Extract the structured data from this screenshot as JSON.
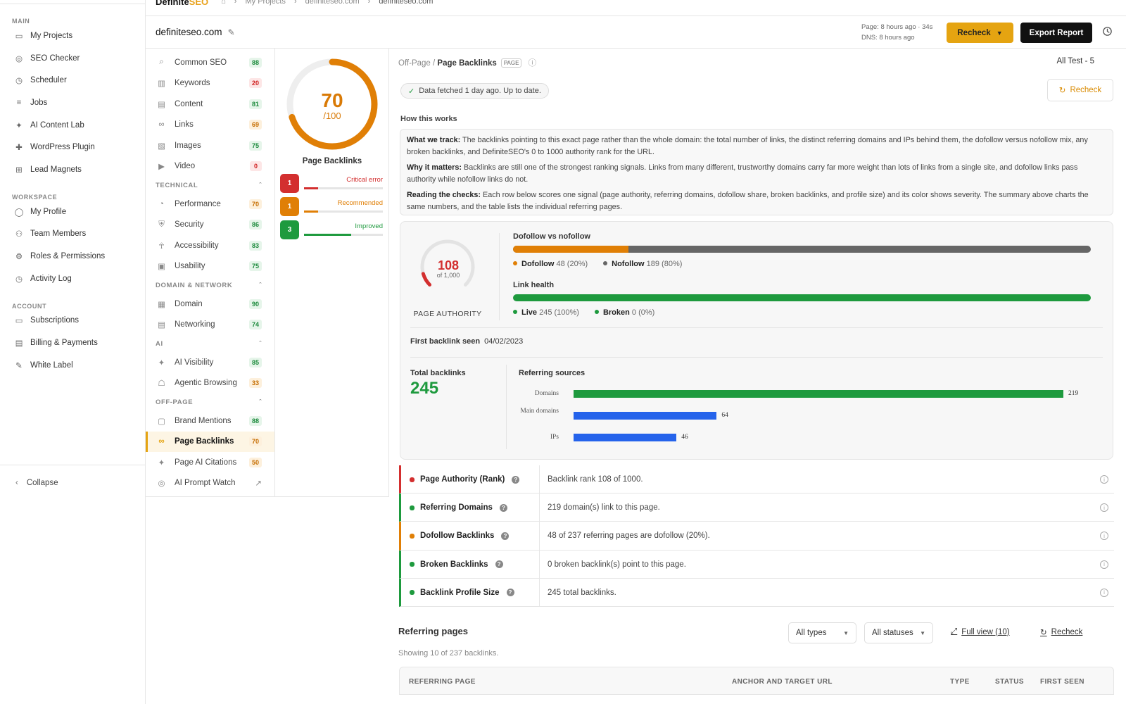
{
  "brand": {
    "name_a": "Definite",
    "name_b": "SEO"
  },
  "breadcrumb": [
    "My Projects",
    "definiteseo.com",
    "definiteseo.com"
  ],
  "nav": {
    "main_label": "MAIN",
    "main": [
      "My Projects",
      "SEO Checker",
      "Scheduler",
      "Jobs",
      "AI Content Lab",
      "WordPress Plugin",
      "Lead Magnets"
    ],
    "workspace_label": "WORKSPACE",
    "workspace": [
      "My Profile",
      "Team Members",
      "Roles & Permissions",
      "Activity Log"
    ],
    "account_label": "ACCOUNT",
    "account": [
      "Subscriptions",
      "Billing & Payments",
      "White Label"
    ],
    "collapse": "Collapse"
  },
  "header": {
    "site": "definiteseo.com",
    "meta_page": "Page: 8 hours ago · 34s",
    "meta_dns": "DNS: 8 hours ago",
    "recheck": "Recheck",
    "export": "Export Report"
  },
  "categories": {
    "general": [
      {
        "label": "Common SEO",
        "score": "88",
        "tone": "g"
      },
      {
        "label": "Keywords",
        "score": "20",
        "tone": "r"
      },
      {
        "label": "Content",
        "score": "81",
        "tone": "g"
      },
      {
        "label": "Links",
        "score": "69",
        "tone": "o"
      },
      {
        "label": "Images",
        "score": "75",
        "tone": "g"
      },
      {
        "label": "Video",
        "score": "0",
        "tone": "r"
      }
    ],
    "technical_label": "TECHNICAL",
    "technical": [
      {
        "label": "Performance",
        "score": "70",
        "tone": "o"
      },
      {
        "label": "Security",
        "score": "86",
        "tone": "g"
      },
      {
        "label": "Accessibility",
        "score": "83",
        "tone": "g"
      },
      {
        "label": "Usability",
        "score": "75",
        "tone": "g"
      }
    ],
    "domain_label": "DOMAIN & NETWORK",
    "domain": [
      {
        "label": "Domain",
        "score": "90",
        "tone": "g"
      },
      {
        "label": "Networking",
        "score": "74",
        "tone": "g"
      }
    ],
    "ai_label": "AI",
    "ai": [
      {
        "label": "AI Visibility",
        "score": "85",
        "tone": "g"
      },
      {
        "label": "Agentic Browsing",
        "score": "33",
        "tone": "o"
      }
    ],
    "offpage_label": "OFF-PAGE",
    "offpage": [
      {
        "label": "Brand Mentions",
        "score": "88",
        "tone": "g"
      },
      {
        "label": "Page Backlinks",
        "score": "70",
        "tone": "o"
      },
      {
        "label": "Page AI Citations",
        "score": "50",
        "tone": "o"
      },
      {
        "label": "AI Prompt Watch",
        "score": "",
        "tone": ""
      }
    ]
  },
  "score": {
    "value": "70",
    "of": "/100",
    "fraction": 0.7,
    "name": "Page Backlinks",
    "stats": [
      {
        "count": "1",
        "label": "Critical error",
        "color": "#d32f2f",
        "fill": 0.18
      },
      {
        "count": "1",
        "label": "Recommended",
        "color": "#e07f06",
        "fill": 0.18
      },
      {
        "count": "3",
        "label": "Improved",
        "color": "#1e9a3e",
        "fill": 0.6
      }
    ]
  },
  "main": {
    "crumb_parent": "Off-Page /",
    "crumb_current": "Page Backlinks",
    "crumb_tag": "PAGE",
    "all_test": "All Test - 5",
    "fetched": "Data fetched 1 day ago. Up to date.",
    "recheck": "Recheck",
    "how_title": "How this works",
    "how": [
      {
        "k": "What we track:",
        "v": " The backlinks pointing to this exact page rather than the whole domain: the total number of links, the distinct referring domains and IPs behind them, the dofollow versus nofollow mix, any broken backlinks, and DefiniteSEO's 0 to 1000 authority rank for the URL."
      },
      {
        "k": "Why it matters:",
        "v": " Backlinks are still one of the strongest ranking signals. Links from many different, trustworthy domains carry far more weight than lots of links from a single site, and dofollow links pass authority while nofollow links do not."
      },
      {
        "k": "Reading the checks:",
        "v": " Each row below scores one signal (page authority, referring domains, dofollow share, broken backlinks, and profile size) and its color shows severity. The summary above charts the same numbers, and the table lists the individual referring pages."
      }
    ]
  },
  "summary": {
    "pa_value": "108",
    "pa_of": "of 1,000",
    "pa_fraction": 0.108,
    "pa_label": "PAGE AUTHORITY",
    "dvn_title": "Dofollow vs nofollow",
    "dofollow_label": "Dofollow",
    "dofollow_val": "48 (20%)",
    "dofollow_share": 0.2,
    "nofollow_label": "Nofollow",
    "nofollow_val": "189 (80%)",
    "health_title": "Link health",
    "live_label": "Live",
    "live_val": "245 (100%)",
    "live_share": 1.0,
    "broken_label": "Broken",
    "broken_val": "0 (0%)",
    "first_seen_label": "First backlink seen",
    "first_seen": "04/02/2023",
    "total_label": "Total backlinks",
    "total": "245",
    "sources_title": "Referring sources",
    "sources": [
      {
        "label": "Domains",
        "value": 219,
        "color": "#1e9a3e"
      },
      {
        "label": "Main domains",
        "value": 64,
        "color": "#2563eb"
      },
      {
        "label": "IPs",
        "value": 46,
        "color": "#2563eb"
      }
    ]
  },
  "checks": [
    {
      "name": "Page Authority (Rank)",
      "msg": "Backlink rank 108 of 1000.",
      "color": "#d32f2f"
    },
    {
      "name": "Referring Domains",
      "msg": "219 domain(s) link to this page.",
      "color": "#1e9a3e"
    },
    {
      "name": "Dofollow Backlinks",
      "msg": "48 of 237 referring pages are dofollow (20%).",
      "color": "#e07f06"
    },
    {
      "name": "Broken Backlinks",
      "msg": "0 broken backlink(s) point to this page.",
      "color": "#1e9a3e"
    },
    {
      "name": "Backlink Profile Size",
      "msg": "245 total backlinks.",
      "color": "#1e9a3e"
    }
  ],
  "referring": {
    "title": "Referring pages",
    "types": "All types",
    "statuses": "All statuses",
    "full_view": "Full view (10)",
    "recheck": "Recheck",
    "showing": "Showing 10 of 237 backlinks.",
    "cols": [
      "REFERRING PAGE",
      "ANCHOR AND TARGET URL",
      "TYPE",
      "STATUS",
      "FIRST SEEN"
    ]
  }
}
